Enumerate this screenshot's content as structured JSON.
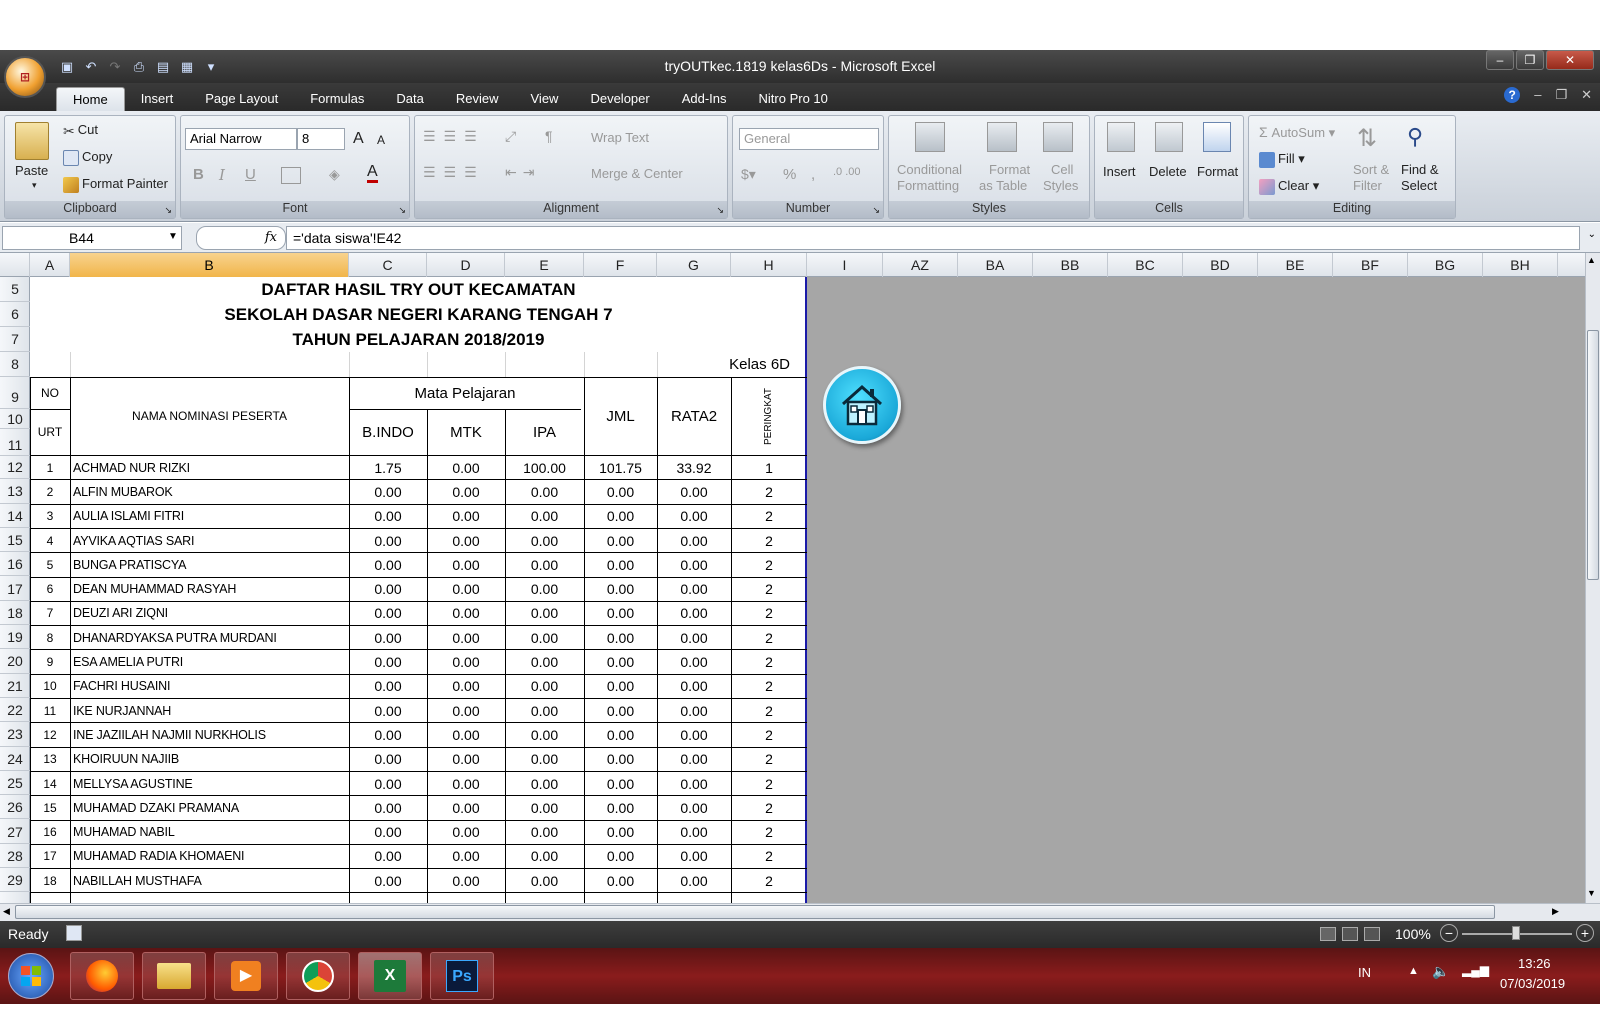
{
  "app": {
    "title": "tryOUTkec.1819 kelas6Ds - Microsoft Excel",
    "window_buttons": [
      "–",
      "❐",
      "✕"
    ],
    "ribbon_right": [
      "?",
      "–",
      "❐",
      "✕"
    ]
  },
  "tabs": [
    "Home",
    "Insert",
    "Page Layout",
    "Formulas",
    "Data",
    "Review",
    "View",
    "Developer",
    "Add-Ins",
    "Nitro Pro 10"
  ],
  "ribbon": {
    "clipboard": {
      "title": "Clipboard",
      "paste": "Paste",
      "cut": "Cut",
      "copy": "Copy",
      "format_painter": "Format Painter"
    },
    "font": {
      "title": "Font",
      "font_name": "Arial Narrow",
      "font_size": "8",
      "bold": "B",
      "italic": "I",
      "underline": "U",
      "grow": "A",
      "shrink": "A",
      "font_color": "A"
    },
    "alignment": {
      "title": "Alignment",
      "wrap_text": "Wrap Text",
      "merge_center": "Merge & Center"
    },
    "number": {
      "title": "Number",
      "format": "General",
      "percent": "%",
      "comma": ","
    },
    "styles": {
      "title": "Styles",
      "conditional": "Conditional",
      "conditional2": "Formatting",
      "format_table": "Format",
      "format_table2": "as Table",
      "cell_styles": "Cell",
      "cell_styles2": "Styles"
    },
    "cells": {
      "title": "Cells",
      "insert": "Insert",
      "delete": "Delete",
      "format": "Format"
    },
    "editing": {
      "title": "Editing",
      "autosum": "AutoSum",
      "fill": "Fill",
      "clear": "Clear",
      "sort": "Sort &",
      "sort2": "Filter",
      "find": "Find &",
      "find2": "Select"
    }
  },
  "formula_bar": {
    "name_box": "B44",
    "fx": "fx",
    "formula": "='data siswa'!E42"
  },
  "columns": [
    "A",
    "B",
    "C",
    "D",
    "E",
    "F",
    "G",
    "H",
    "I",
    "AZ",
    "BA",
    "BB",
    "BC",
    "BD",
    "BE",
    "BF",
    "BG",
    "BH"
  ],
  "sheet": {
    "title1": "DAFTAR HASIL TRY OUT KECAMATAN",
    "title2": "SEKOLAH DASAR NEGERI KARANG TENGAH 7",
    "title3": "TAHUN PELAJARAN 2018/2019",
    "kelas": "Kelas 6D",
    "hdr_no": "NO",
    "hdr_urt": "URT",
    "hdr_nama": "NAMA NOMINASI PESERTA",
    "hdr_mapel": "Mata Pelajaran",
    "hdr_bindo": "B.INDO",
    "hdr_mtk": "MTK",
    "hdr_ipa": "IPA",
    "hdr_jml": "JML",
    "hdr_rata": "RATA2",
    "hdr_peringkat": "PERINGKAT",
    "rows": [
      {
        "row": "12",
        "no": "1",
        "nama": "ACHMAD NUR RIZKI",
        "bindo": "1.75",
        "mtk": "0.00",
        "ipa": "100.00",
        "jml": "101.75",
        "rata": "33.92",
        "rank": "1"
      },
      {
        "row": "13",
        "no": "2",
        "nama": "ALFIN MUBAROK",
        "bindo": "0.00",
        "mtk": "0.00",
        "ipa": "0.00",
        "jml": "0.00",
        "rata": "0.00",
        "rank": "2"
      },
      {
        "row": "14",
        "no": "3",
        "nama": "AULIA ISLAMI FITRI",
        "bindo": "0.00",
        "mtk": "0.00",
        "ipa": "0.00",
        "jml": "0.00",
        "rata": "0.00",
        "rank": "2"
      },
      {
        "row": "15",
        "no": "4",
        "nama": "AYVIKA AQTIAS SARI",
        "bindo": "0.00",
        "mtk": "0.00",
        "ipa": "0.00",
        "jml": "0.00",
        "rata": "0.00",
        "rank": "2"
      },
      {
        "row": "16",
        "no": "5",
        "nama": "BUNGA PRATISCYA",
        "bindo": "0.00",
        "mtk": "0.00",
        "ipa": "0.00",
        "jml": "0.00",
        "rata": "0.00",
        "rank": "2"
      },
      {
        "row": "17",
        "no": "6",
        "nama": "DEAN MUHAMMAD RASYAH",
        "bindo": "0.00",
        "mtk": "0.00",
        "ipa": "0.00",
        "jml": "0.00",
        "rata": "0.00",
        "rank": "2"
      },
      {
        "row": "18",
        "no": "7",
        "nama": "DEUZI ARI ZIQNI",
        "bindo": "0.00",
        "mtk": "0.00",
        "ipa": "0.00",
        "jml": "0.00",
        "rata": "0.00",
        "rank": "2"
      },
      {
        "row": "19",
        "no": "8",
        "nama": "DHANARDYAKSA PUTRA MURDANI",
        "bindo": "0.00",
        "mtk": "0.00",
        "ipa": "0.00",
        "jml": "0.00",
        "rata": "0.00",
        "rank": "2"
      },
      {
        "row": "20",
        "no": "9",
        "nama": "ESA AMELIA PUTRI",
        "bindo": "0.00",
        "mtk": "0.00",
        "ipa": "0.00",
        "jml": "0.00",
        "rata": "0.00",
        "rank": "2"
      },
      {
        "row": "21",
        "no": "10",
        "nama": "FACHRI HUSAINI",
        "bindo": "0.00",
        "mtk": "0.00",
        "ipa": "0.00",
        "jml": "0.00",
        "rata": "0.00",
        "rank": "2"
      },
      {
        "row": "22",
        "no": "11",
        "nama": "IKE NURJANNAH",
        "bindo": "0.00",
        "mtk": "0.00",
        "ipa": "0.00",
        "jml": "0.00",
        "rata": "0.00",
        "rank": "2"
      },
      {
        "row": "23",
        "no": "12",
        "nama": "INE JAZIILAH NAJMII NURKHOLIS",
        "bindo": "0.00",
        "mtk": "0.00",
        "ipa": "0.00",
        "jml": "0.00",
        "rata": "0.00",
        "rank": "2"
      },
      {
        "row": "24",
        "no": "13",
        "nama": "KHOIRUUN NAJIIB",
        "bindo": "0.00",
        "mtk": "0.00",
        "ipa": "0.00",
        "jml": "0.00",
        "rata": "0.00",
        "rank": "2"
      },
      {
        "row": "25",
        "no": "14",
        "nama": "MELLYSA AGUSTINE",
        "bindo": "0.00",
        "mtk": "0.00",
        "ipa": "0.00",
        "jml": "0.00",
        "rata": "0.00",
        "rank": "2"
      },
      {
        "row": "26",
        "no": "15",
        "nama": "MUHAMAD DZAKI PRAMANA",
        "bindo": "0.00",
        "mtk": "0.00",
        "ipa": "0.00",
        "jml": "0.00",
        "rata": "0.00",
        "rank": "2"
      },
      {
        "row": "27",
        "no": "16",
        "nama": "MUHAMAD NABIL",
        "bindo": "0.00",
        "mtk": "0.00",
        "ipa": "0.00",
        "jml": "0.00",
        "rata": "0.00",
        "rank": "2"
      },
      {
        "row": "28",
        "no": "17",
        "nama": "MUHAMAD RADIA KHOMAENI",
        "bindo": "0.00",
        "mtk": "0.00",
        "ipa": "0.00",
        "jml": "0.00",
        "rata": "0.00",
        "rank": "2"
      },
      {
        "row": "29",
        "no": "18",
        "nama": "NABILLAH MUSTHAFA",
        "bindo": "0.00",
        "mtk": "0.00",
        "ipa": "0.00",
        "jml": "0.00",
        "rata": "0.00",
        "rank": "2"
      }
    ]
  },
  "status": {
    "ready": "Ready",
    "zoom": "100%"
  },
  "taskbar": {
    "lang": "IN",
    "time": "13:26",
    "date": "07/03/2019"
  }
}
